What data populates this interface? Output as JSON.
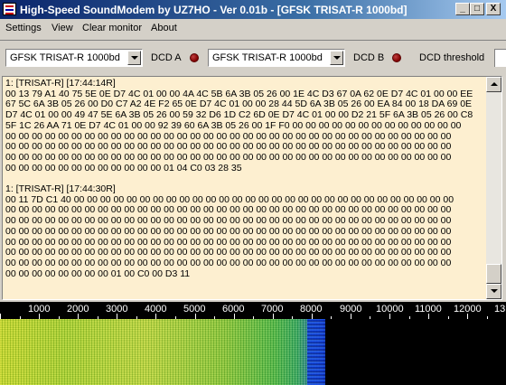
{
  "window": {
    "title": "High-Speed SoundModem by UZ7HO - Ver 0.01b - [GFSK TRISAT-R 1000bd]",
    "min_glyph": "_",
    "max_glyph": "□",
    "close_glyph": "X"
  },
  "menu": {
    "settings": "Settings",
    "view": "View",
    "clear_monitor": "Clear monitor",
    "about": "About"
  },
  "toolbar": {
    "modem_a": "GFSK TRISAT-R 1000bd",
    "dcd_a_label": "DCD A",
    "modem_b": "GFSK TRISAT-R 1000bd",
    "dcd_b_label": "DCD B",
    "dcd_threshold_label": "DCD threshold"
  },
  "monitor": {
    "text": "1: [TRISAT-R] [17:44:14R]\n00 13 79 A1 40 75 5E 0E D7 4C 01 00 00 4A 4C 5B 6A 3B 05 26 00 1E 4C D3 67 0A 62 0E D7 4C 01 00 00 EE\n67 5C 6A 3B 05 26 00 D0 C7 A2 4E F2 65 0E D7 4C 01 00 00 28 44 5D 6A 3B 05 26 00 EA 84 00 18 DA 69 0E\nD7 4C 01 00 00 49 47 5E 6A 3B 05 26 00 59 32 D6 1D C2 6D 0E D7 4C 01 00 00 D2 21 5F 6A 3B 05 26 00 C8\n5F 1C 26 AA 71 0E D7 4C 01 00 00 92 39 60 6A 3B 05 26 00 1F F0 00 00 00 00 00 00 00 00 00 00 00 00 00\n00 00 00 00 00 00 00 00 00 00 00 00 00 00 00 00 00 00 00 00 00 00 00 00 00 00 00 00 00 00 00 00 00 00\n00 00 00 00 00 00 00 00 00 00 00 00 00 00 00 00 00 00 00 00 00 00 00 00 00 00 00 00 00 00 00 00 00 00\n00 00 00 00 00 00 00 00 00 00 00 00 00 00 00 00 00 00 00 00 00 00 00 00 00 00 00 00 00 00 00 00 00 00\n00 00 00 00 00 00 00 00 00 00 00 00 01 04 C0 03 28 35\n\n1: [TRISAT-R] [17:44:30R]\n00 11 7D C1 40 00 00 00 00 00 00 00 00 00 00 00 00 00 00 00 00 00 00 00 00 00 00 00 00 00 00 00 00 00\n00 00 00 00 00 00 00 00 00 00 00 00 00 00 00 00 00 00 00 00 00 00 00 00 00 00 00 00 00 00 00 00 00 00\n00 00 00 00 00 00 00 00 00 00 00 00 00 00 00 00 00 00 00 00 00 00 00 00 00 00 00 00 00 00 00 00 00 00\n00 00 00 00 00 00 00 00 00 00 00 00 00 00 00 00 00 00 00 00 00 00 00 00 00 00 00 00 00 00 00 00 00 00\n00 00 00 00 00 00 00 00 00 00 00 00 00 00 00 00 00 00 00 00 00 00 00 00 00 00 00 00 00 00 00 00 00 00\n00 00 00 00 00 00 00 00 00 00 00 00 00 00 00 00 00 00 00 00 00 00 00 00 00 00 00 00 00 00 00 00 00 00\n00 00 00 00 00 00 00 00 00 00 00 00 00 00 00 00 00 00 00 00 00 00 00 00 00 00 00 00 00 00 00 00 00 00\n00 00 00 00 00 00 00 00 01 00 C0 00 D3 11"
  },
  "spectrum": {
    "frequency_ticks": [
      "1000",
      "2000",
      "3000",
      "4000",
      "5000",
      "6000",
      "7000",
      "8000",
      "9000",
      "10000",
      "11000",
      "12000",
      "13"
    ]
  }
}
